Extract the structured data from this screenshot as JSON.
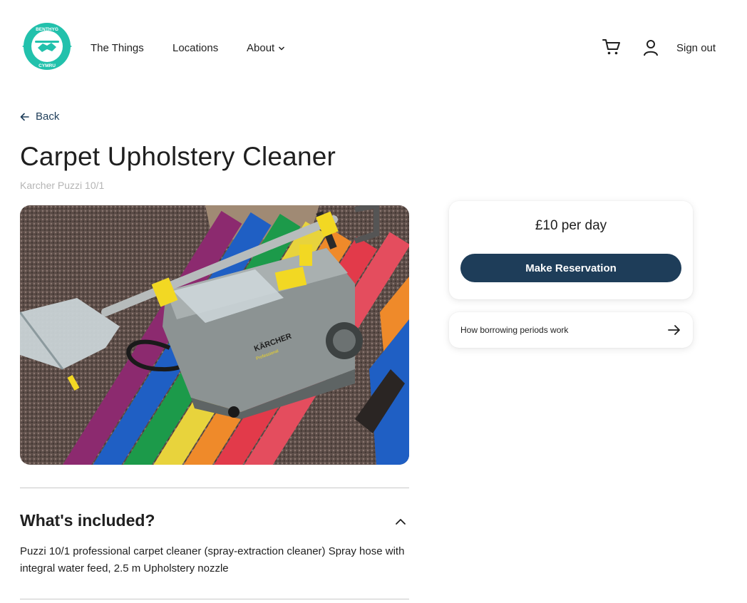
{
  "header": {
    "logo": {
      "top_text": "BENTHYG",
      "bottom_text": "CYMRU"
    },
    "nav": {
      "things": "The Things",
      "locations": "Locations",
      "about": "About"
    },
    "sign_out": "Sign out"
  },
  "back_label": "Back",
  "product": {
    "title": "Carpet Upholstery Cleaner",
    "model": "Karcher Puzzi 10/1",
    "image_text": {
      "brand": "KÄRCHER",
      "line": "Professional"
    }
  },
  "pricing": {
    "price": "£10 per day",
    "reserve_label": "Make Reservation"
  },
  "borrowing_link": "How borrowing periods work",
  "included": {
    "heading": "What's included?",
    "body": "Puzzi 10/1 professional carpet cleaner (spray-extraction cleaner) Spray hose with integral water feed, 2.5 m Upholstery nozzle"
  },
  "colors": {
    "brand_teal": "#22c1ac",
    "button_navy": "#1e3d59",
    "link_navy": "#1f3e5a",
    "subtitle_gray": "#b5b5b5"
  },
  "icons": {
    "cart": "cart-icon",
    "user": "user-icon",
    "about_chevron": "chevron-down-icon",
    "back": "arrow-left-icon",
    "periods": "arrow-right-icon",
    "accordion": "chevron-up-icon"
  }
}
